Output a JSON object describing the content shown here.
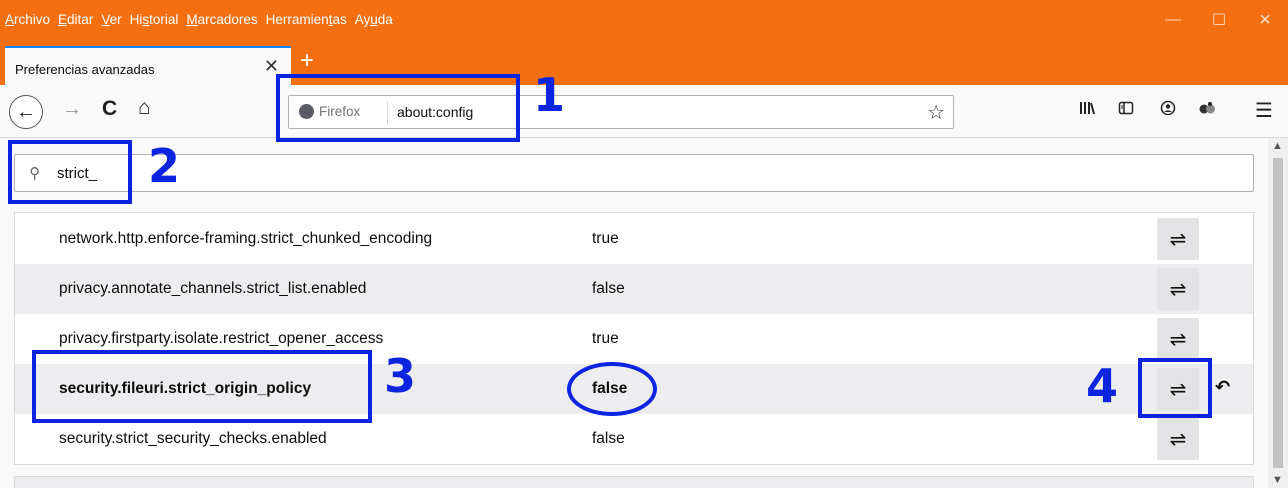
{
  "menu": [
    {
      "pre": "",
      "u": "A",
      "post": "rchivo"
    },
    {
      "pre": "",
      "u": "E",
      "post": "ditar"
    },
    {
      "pre": "",
      "u": "V",
      "post": "er"
    },
    {
      "pre": "Hi",
      "u": "s",
      "post": "torial"
    },
    {
      "pre": "",
      "u": "M",
      "post": "arcadores"
    },
    {
      "pre": "Herramien",
      "u": "t",
      "post": "as"
    },
    {
      "pre": "Ay",
      "u": "u",
      "post": "da"
    }
  ],
  "window_controls": {
    "minimize": "—",
    "maximize": "☐",
    "close": "✕"
  },
  "tab": {
    "title": "Preferencias avanzadas",
    "close": "✕",
    "new_tab": "+"
  },
  "urlbar": {
    "identity": "Firefox",
    "url": "about:config"
  },
  "search": {
    "value": "strict_"
  },
  "prefs": [
    {
      "name": "network.http.enforce-framing.strict_chunked_encoding",
      "value": "true",
      "modified": false
    },
    {
      "name": "privacy.annotate_channels.strict_list.enabled",
      "value": "false",
      "modified": false
    },
    {
      "name": "privacy.firstparty.isolate.restrict_opener_access",
      "value": "true",
      "modified": false
    },
    {
      "name": "security.fileuri.strict_origin_policy",
      "value": "false",
      "modified": true
    },
    {
      "name": "security.strict_security_checks.enabled",
      "value": "false",
      "modified": false
    }
  ],
  "annotations": [
    "1",
    "2",
    "3",
    "4"
  ],
  "icons": {
    "toggle": "⇌",
    "reset": "↶",
    "back": "←",
    "forward": "→",
    "reload": "C",
    "home": "⌂",
    "star": "☆",
    "search": "⚲"
  },
  "colors": {
    "titlebar": "#f36f10",
    "annotation": "#0b24e0",
    "tab_accent": "#0a84ff"
  }
}
